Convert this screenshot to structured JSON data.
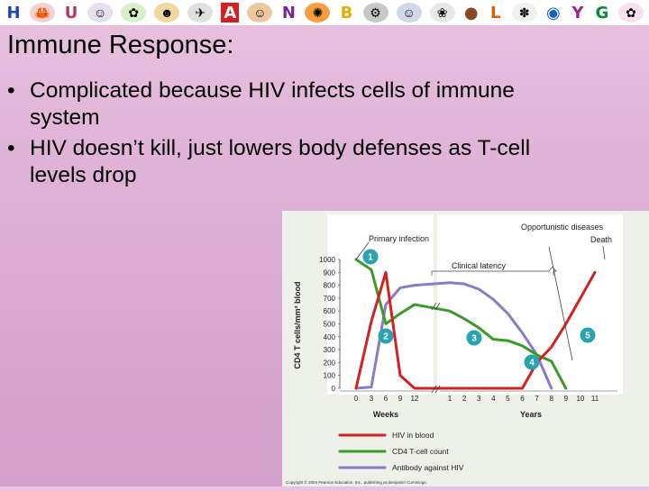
{
  "banner": {
    "letters": [
      "H",
      "U",
      "A",
      "N",
      "B",
      "L",
      "G",
      "Y"
    ],
    "colors": {
      "h": "#1e3fd0",
      "u": "#c0306a",
      "a": "#d62020",
      "n": "#7a1fa0",
      "b": "#e0b000",
      "l": "#e05a00",
      "o": "#1560c0",
      "g": "#0a8a3a",
      "y": "#a0208a"
    },
    "icons": [
      "crab-icon",
      "kid-icon",
      "bug-icon",
      "face-icon",
      "rocket-icon",
      "dora-icon",
      "alien-icon",
      "robot-icon",
      "stewie-icon",
      "bunny-icon",
      "frog-icon",
      "lion-icon",
      "flower-icon"
    ]
  },
  "slide": {
    "title": "Immune Response:",
    "bullets": [
      "Complicated because HIV infects cells of immune system",
      "HIV doesn’t kill, just lowers body defenses as T-cell levels drop"
    ]
  },
  "chart_data": {
    "type": "line",
    "ylabel": "CD4 T cells/mm³ blood",
    "yticks": [
      0,
      100,
      200,
      300,
      400,
      500,
      600,
      700,
      800,
      900,
      1000
    ],
    "ylim": [
      0,
      1000
    ],
    "x_groups": {
      "weeks": {
        "label": "Weeks",
        "ticks": [
          "0",
          "3",
          "6",
          "9",
          "12"
        ]
      },
      "years": {
        "label": "Years",
        "ticks": [
          "1",
          "2",
          "3",
          "4",
          "5",
          "6",
          "7",
          "8",
          "9",
          "10",
          "11"
        ]
      }
    },
    "series": [
      {
        "name": "HIV in blood",
        "color": "#d42020",
        "x": [
          "0 wk",
          "3 wk",
          "6 wk",
          "9 wk",
          "12 wk",
          "1 yr",
          "6 yr",
          "7 yr",
          "8 yr",
          "9 yr",
          "11 yr"
        ],
        "y": [
          0,
          520,
          900,
          100,
          0,
          0,
          0,
          200,
          320,
          500,
          900
        ]
      },
      {
        "name": "CD4 T-cell count",
        "color": "#3a9a2a",
        "x": [
          "0 wk",
          "3 wk",
          "6 wk",
          "9 wk",
          "12 wk",
          "1 yr",
          "2 yr",
          "3 yr",
          "4 yr",
          "5 yr",
          "6 yr",
          "7 yr",
          "8 yr",
          "9 yr"
        ],
        "y": [
          1000,
          920,
          500,
          580,
          650,
          600,
          540,
          470,
          380,
          370,
          330,
          260,
          210,
          0
        ]
      },
      {
        "name": "Antibody against HIV",
        "color": "#8a7ac8",
        "x": [
          "0 wk",
          "3 wk",
          "6 wk",
          "9 wk",
          "12 wk",
          "1 yr",
          "2 yr",
          "3 yr",
          "4 yr",
          "5 yr",
          "6 yr",
          "7 yr",
          "8 yr"
        ],
        "y": [
          0,
          10,
          650,
          780,
          800,
          820,
          810,
          770,
          690,
          580,
          430,
          260,
          0
        ]
      }
    ],
    "annotations": [
      {
        "text": "Primary infection"
      },
      {
        "text": "Clinical latency"
      },
      {
        "text": "Opportunistic diseases"
      },
      {
        "text": "Death"
      }
    ],
    "stage_markers": [
      "1",
      "2",
      "3",
      "4",
      "5"
    ],
    "legend": [
      "HIV in blood",
      "CD4 T-cell count",
      "Antibody against HIV"
    ],
    "legend_placement": "bottom",
    "credit": "Copyright © 2004 Pearson Education, Inc., publishing as Benjamin Cummings."
  }
}
